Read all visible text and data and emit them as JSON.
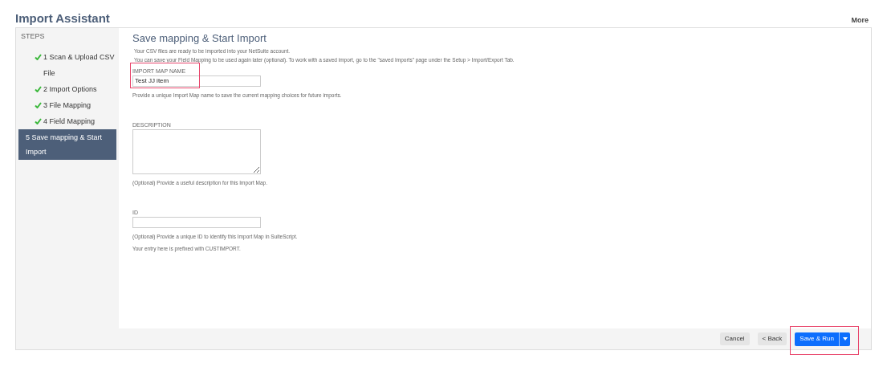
{
  "header": {
    "title": "Import Assistant",
    "more": "More"
  },
  "steps": {
    "heading": "STEPS",
    "items": [
      {
        "label": "1 Scan & Upload CSV File",
        "completed": true,
        "selected": false
      },
      {
        "label": "2 Import Options",
        "completed": true,
        "selected": false
      },
      {
        "label": "3 File Mapping",
        "completed": true,
        "selected": false
      },
      {
        "label": "4 Field Mapping",
        "completed": true,
        "selected": false
      },
      {
        "label": "5 Save mapping & Start Import",
        "completed": false,
        "selected": true
      }
    ]
  },
  "content": {
    "title": "Save mapping & Start Import",
    "intro": [
      "Your CSV files are ready to be imported into your NetSuite account.",
      "You can save your Field Mapping to be used again later (optional). To work with a saved import, go to the \"saved Imports\" page under the Setup > Import/Export Tab."
    ],
    "fields": [
      {
        "kind": "input",
        "label": "IMPORT MAP NAME",
        "value": "Test JJ item",
        "help": [
          "Provide a unique Import Map name to save the current mapping choices for future imports."
        ]
      },
      {
        "kind": "textarea",
        "label": "DESCRIPTION",
        "help": [
          "(Optional) Provide a useful description for this Import Map."
        ]
      },
      {
        "kind": "input",
        "label": "ID",
        "help": [
          "(Optional) Provide a unique ID to identify this Import Map in SuiteScript.",
          "Your entry here is prefixed with CUSTIMPORT."
        ]
      }
    ]
  },
  "footer": {
    "cancel": "Cancel",
    "back": "< Back",
    "save": "Save & Run"
  }
}
